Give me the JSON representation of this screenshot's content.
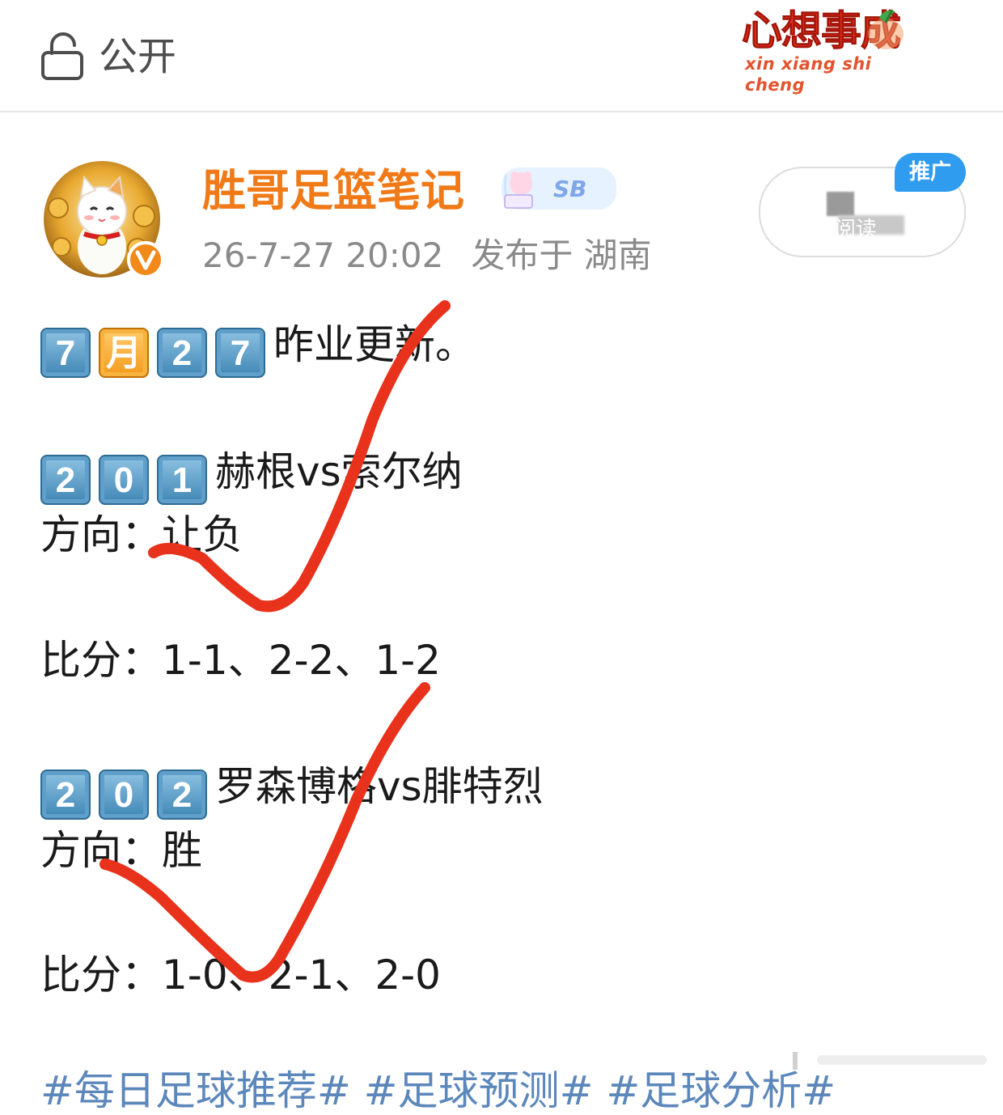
{
  "header": {
    "visibility_label": "公开",
    "brand_title": "心想事成",
    "brand_pinyin": "xin xiang shi cheng"
  },
  "author": {
    "name": "胜哥足篮笔记",
    "badge_text": "SB",
    "timestamp": "26-7-27 20:02",
    "location": "发布于 湖南"
  },
  "promo": {
    "tag": "推广",
    "read_label": "阅读"
  },
  "post": {
    "date_keys": [
      "7",
      "月",
      "2",
      "7"
    ],
    "headline": "昨业更新。",
    "matches": [
      {
        "number_keys": [
          "2",
          "0",
          "1"
        ],
        "teams": "赫根vs索尔纳",
        "direction": "方向：让负",
        "score": "比分：1-1、2-2、1-2"
      },
      {
        "number_keys": [
          "2",
          "0",
          "2"
        ],
        "teams": "罗森博格vs腓特烈",
        "direction": "方向：胜",
        "score": "比分：1-0、2-1、2-0"
      }
    ],
    "hashtags": "#每日足球推荐# #足球预测# #足球分析#"
  },
  "colors": {
    "author": "#f07a18",
    "check_mark": "#e8321c",
    "promo_tag": "#2f9cf0"
  }
}
